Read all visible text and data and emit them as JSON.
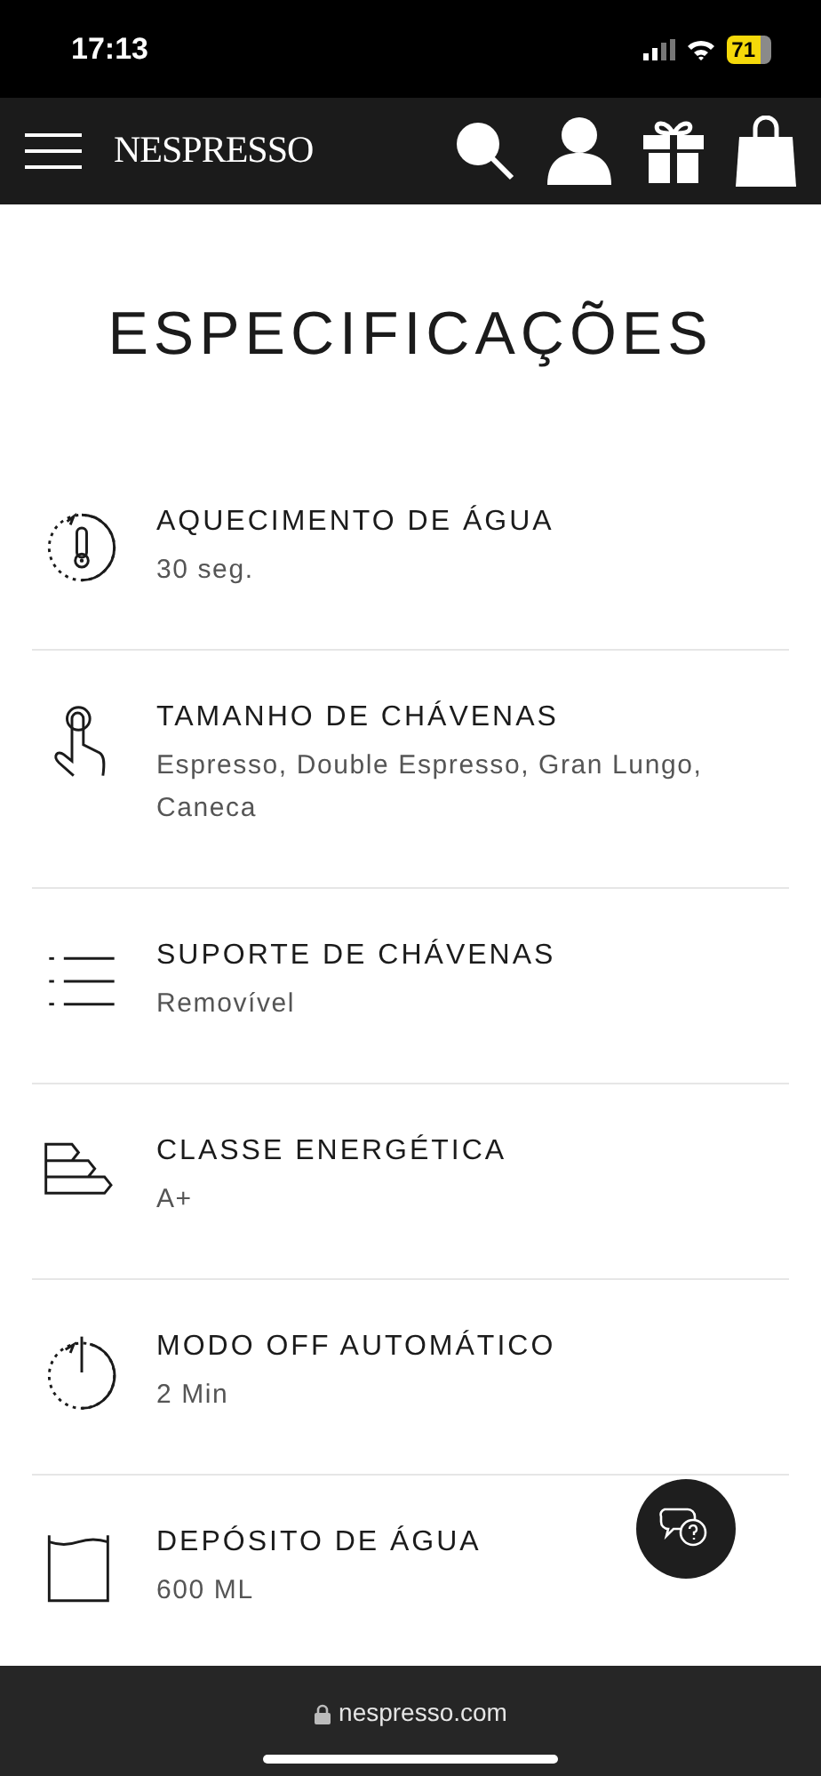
{
  "status_bar": {
    "time": "17:13",
    "battery": "71"
  },
  "nav": {
    "logo": "NESPRESSO"
  },
  "title": "ESPECIFICAÇÕES",
  "specs": [
    {
      "kind": "heating",
      "label": "AQUECIMENTO DE ÁGUA",
      "value": "30 seg."
    },
    {
      "kind": "cup_size",
      "label": "TAMANHO DE CHÁVENAS",
      "value": "Espresso, Double Espresso, Gran Lungo, Caneca"
    },
    {
      "kind": "tray",
      "label": "SUPORTE DE CHÁVENAS",
      "value": "Removível"
    },
    {
      "kind": "energy",
      "label": "CLASSE ENERGÉTICA",
      "value": "A+"
    },
    {
      "kind": "auto_off",
      "label": "MODO OFF AUTOMÁTICO",
      "value": "2 Min"
    },
    {
      "kind": "tank",
      "label": "DEPÓSITO DE ÁGUA",
      "value": "600 ML"
    }
  ],
  "browser_bar": {
    "url": "nespresso.com"
  }
}
